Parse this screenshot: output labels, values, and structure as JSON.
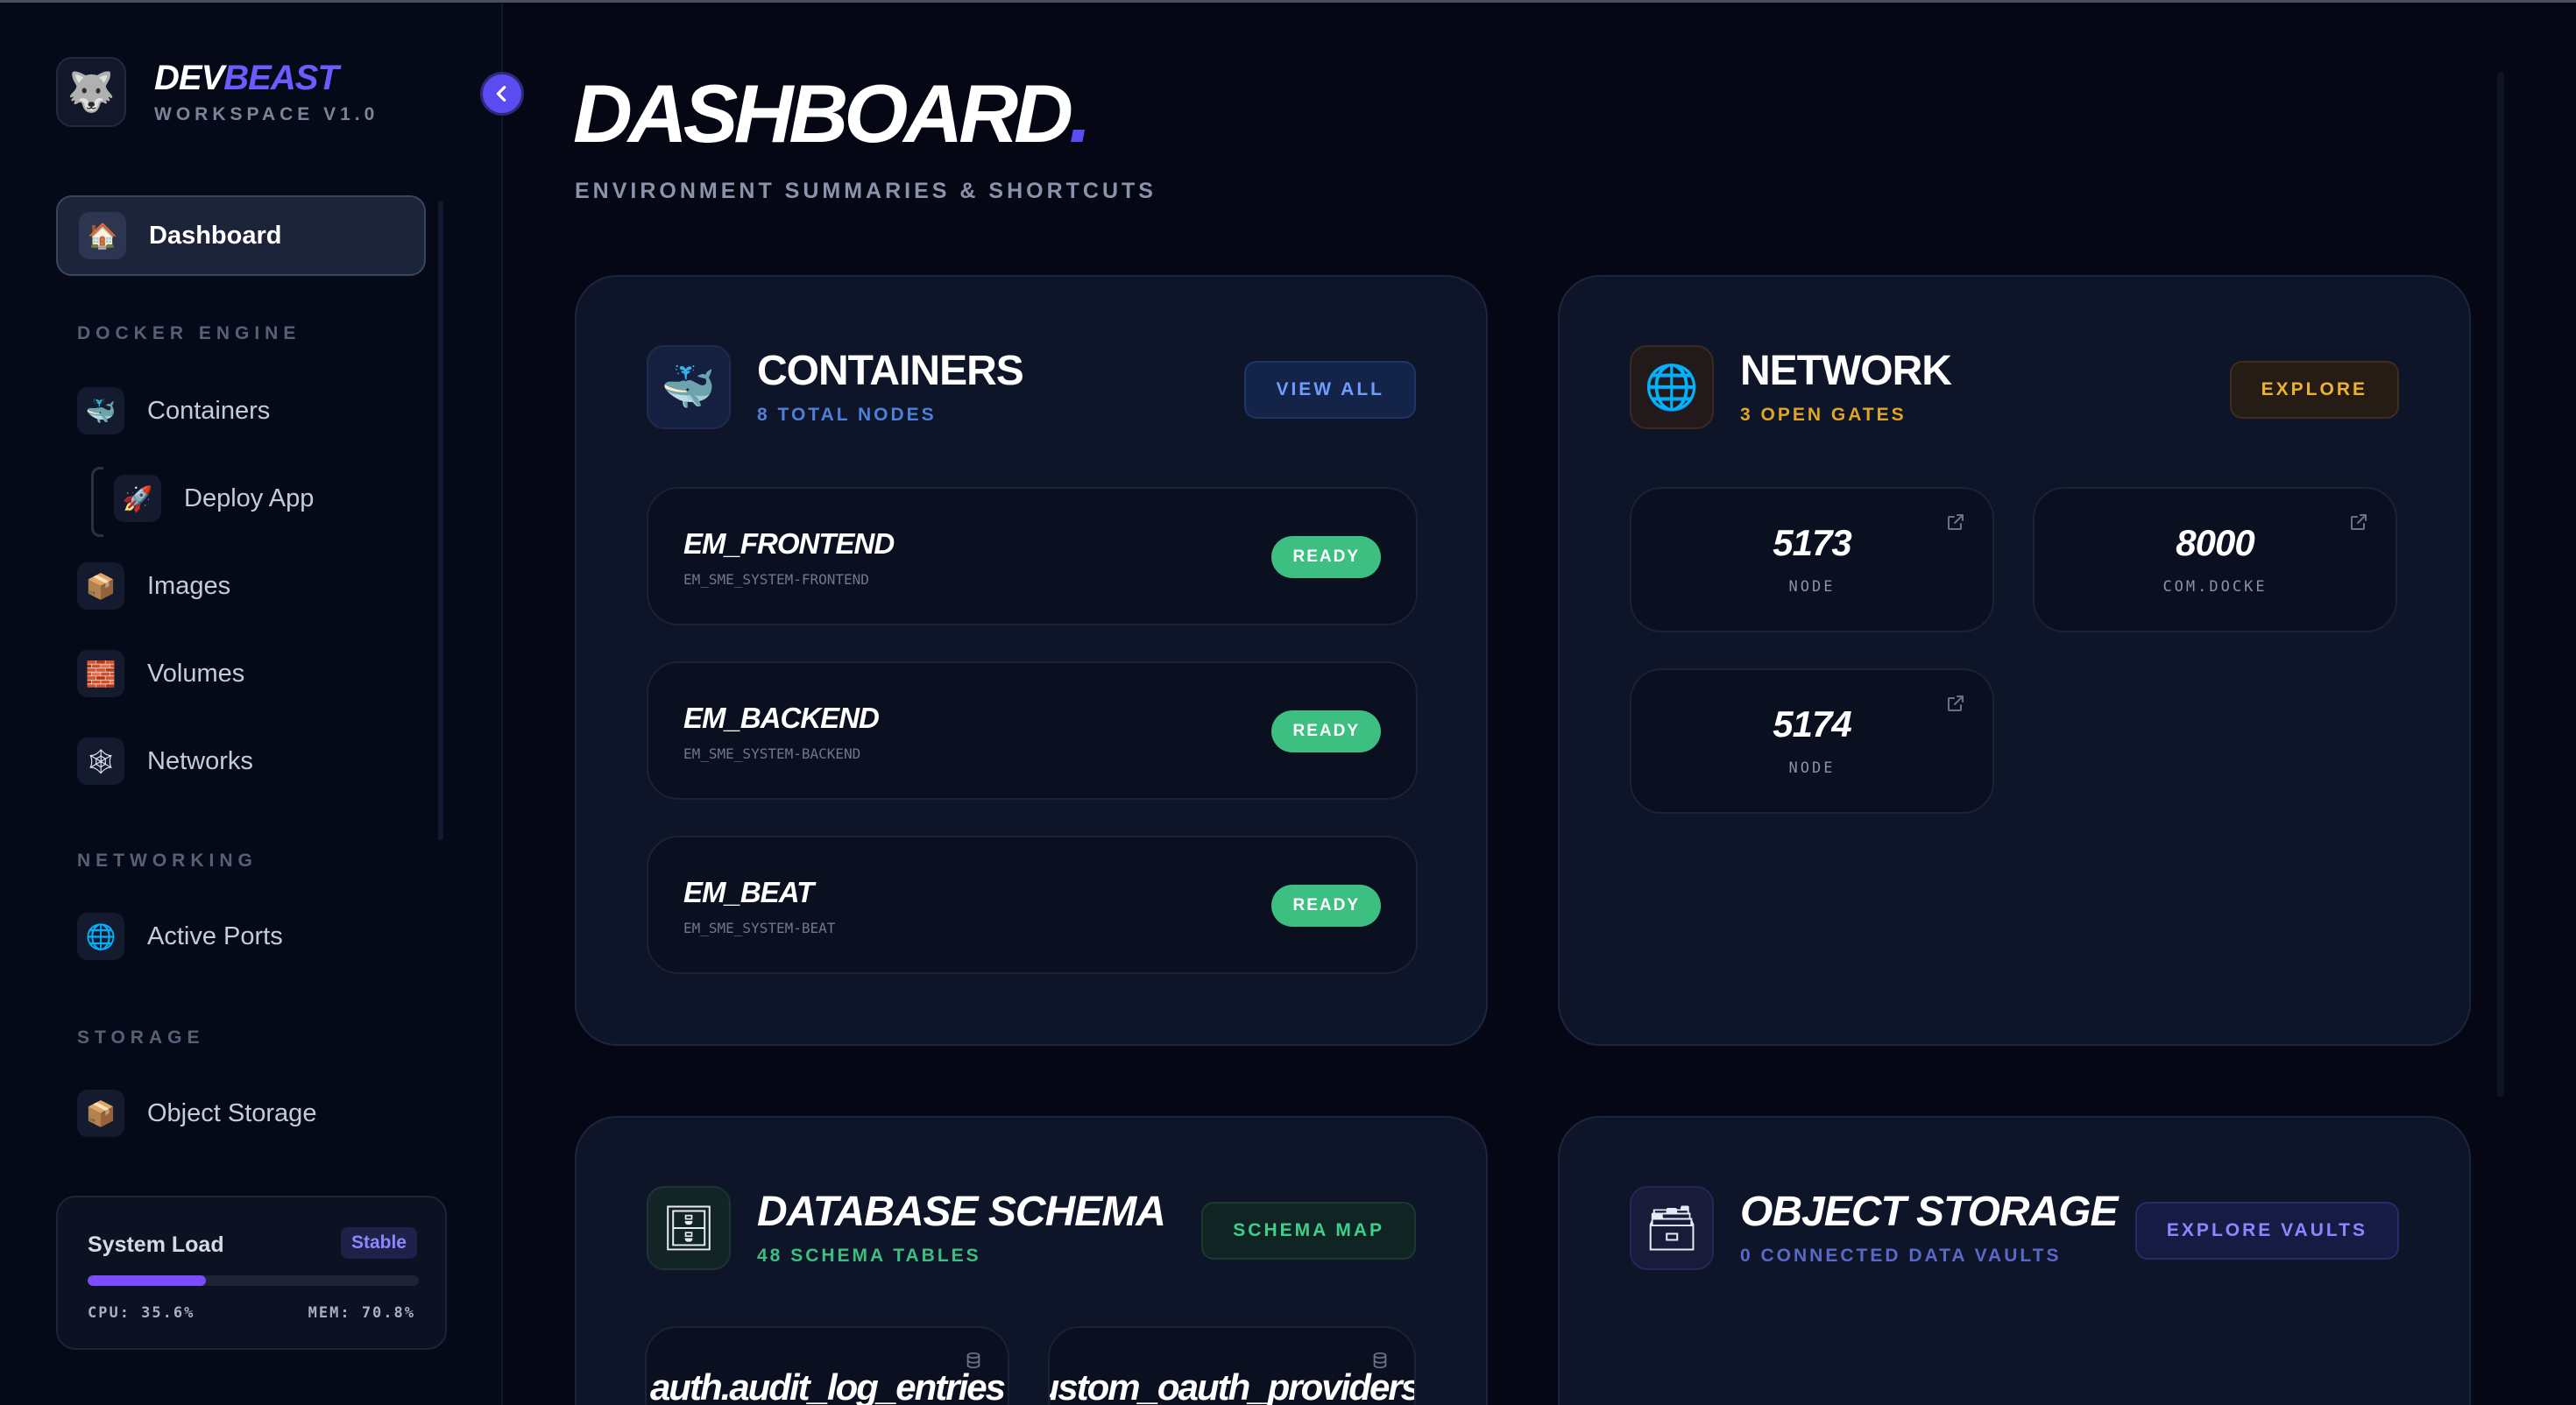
{
  "brand": {
    "logo_icon": "wolf-icon",
    "name_part1": "DEV",
    "name_part2": "BEAST",
    "subtitle": "WORKSPACE V1.0",
    "accent": "#6b5cff"
  },
  "sidebar": {
    "active_item": {
      "label": "Dashboard",
      "icon": "house-icon"
    },
    "sections": [
      {
        "title": "DOCKER ENGINE"
      },
      {
        "title": "NETWORKING"
      },
      {
        "title": "STORAGE"
      }
    ],
    "docker_items": [
      {
        "label": "Containers",
        "icon": "whale-icon"
      },
      {
        "label": "Deploy App",
        "icon": "rocket-icon"
      },
      {
        "label": "Images",
        "icon": "package-icon"
      },
      {
        "label": "Volumes",
        "icon": "stack-icon"
      },
      {
        "label": "Networks",
        "icon": "web-icon"
      }
    ],
    "networking_items": [
      {
        "label": "Active Ports",
        "icon": "globe-icon"
      }
    ],
    "storage_items": [
      {
        "label": "Object Storage",
        "icon": "box-icon"
      }
    ],
    "system_load": {
      "title": "System Load",
      "badge": "Stable",
      "progress": 0.356,
      "cpu": "CPU: 35.6%",
      "mem": "MEM: 70.8%",
      "bar_color": "#7c4dff"
    }
  },
  "main": {
    "title": "DASHBOARD",
    "title_dot": ".",
    "subtitle": "ENVIRONMENT SUMMARIES & SHORTCUTS",
    "containers_card": {
      "title": "CONTAINERS",
      "subtitle": "8 TOTAL NODES",
      "button": "VIEW ALL",
      "icon": "whale-icon",
      "rows": [
        {
          "name": "EM_FRONTEND",
          "id": "EM_SME_SYSTEM-FRONTEND",
          "status": "READY"
        },
        {
          "name": "EM_BACKEND",
          "id": "EM_SME_SYSTEM-BACKEND",
          "status": "READY"
        },
        {
          "name": "EM_BEAT",
          "id": "EM_SME_SYSTEM-BEAT",
          "status": "READY"
        }
      ],
      "status_color": "#3cbf80"
    },
    "network_card": {
      "title": "NETWORK",
      "subtitle": "3 OPEN GATES",
      "button": "EXPLORE",
      "icon": "globe-icon",
      "ports": [
        {
          "port": "5173",
          "name": "NODE"
        },
        {
          "port": "8000",
          "name": "COM.DOCKE"
        },
        {
          "port": "5174",
          "name": "NODE"
        }
      ],
      "accent": "#e0a526"
    },
    "database_card": {
      "title": "DATABASE SCHEMA",
      "subtitle": "48 SCHEMA TABLES",
      "button": "SCHEMA MAP",
      "icon": "cabinet-icon",
      "tables": [
        "auth.audit_log_entries",
        "auth.custom_oauth_providers"
      ],
      "accent": "#3cbf80"
    },
    "storage_card": {
      "title": "OBJECT STORAGE",
      "subtitle": "0 CONNECTED DATA VAULTS",
      "button": "EXPLORE VAULTS",
      "icon": "card-box-icon",
      "accent": "#8e86ff"
    }
  }
}
